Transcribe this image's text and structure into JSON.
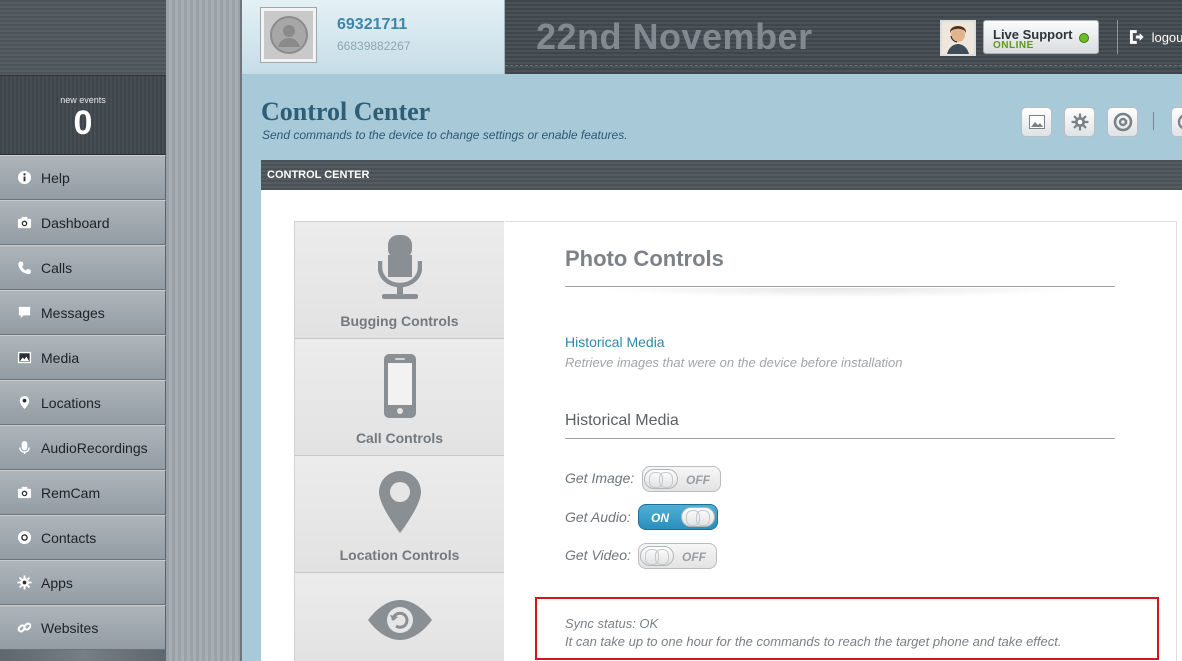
{
  "sidebar": {
    "events_label": "new events",
    "events_count": "0",
    "items": [
      {
        "label": "Help",
        "icon": "info-icon"
      },
      {
        "label": "Dashboard",
        "icon": "camera-icon"
      },
      {
        "label": "Calls",
        "icon": "phone-icon"
      },
      {
        "label": "Messages",
        "icon": "message-icon"
      },
      {
        "label": "Media",
        "icon": "image-icon"
      },
      {
        "label": "Locations",
        "icon": "location-pin-icon"
      },
      {
        "label": "AudioRecordings",
        "icon": "microphone-icon"
      },
      {
        "label": "RemCam",
        "icon": "camera-icon"
      },
      {
        "label": "Contacts",
        "icon": "contacts-icon"
      },
      {
        "label": "Apps",
        "icon": "gear-icon"
      },
      {
        "label": "Websites",
        "icon": "link-icon"
      }
    ]
  },
  "header": {
    "phone_number": "69321711",
    "imei": "66839882267",
    "date": "22nd November",
    "support_title": "Live Support",
    "support_status": "ONLINE",
    "logout_label": "logout"
  },
  "control_center": {
    "title": "Control Center",
    "subtitle": "Send commands to the device to change settings or enable features.",
    "bar_label": "CONTROL CENTER",
    "toolbar_icons": [
      "image-icon",
      "gear-icon",
      "at-icon",
      "circle-icon"
    ]
  },
  "tabs": [
    {
      "label": "Bugging Controls",
      "icon": "microphone-icon"
    },
    {
      "label": "Call Controls",
      "icon": "mobile-phone-icon"
    },
    {
      "label": "Location Controls",
      "icon": "location-pin-icon"
    },
    {
      "label": "",
      "icon": "eye-refresh-icon"
    }
  ],
  "photo": {
    "title": "Photo Controls",
    "link_label": "Historical Media",
    "link_description": "Retrieve images that were on the device before installation",
    "section_heading": "Historical Media",
    "controls": [
      {
        "label": "Get Image:",
        "state": "OFF"
      },
      {
        "label": "Get Audio:",
        "state": "ON"
      },
      {
        "label": "Get Video:",
        "state": "OFF"
      }
    ],
    "sync_status": "Sync status: OK",
    "sync_note": "It can take up to one hour for the commands to reach the target phone and take effect."
  },
  "colors": {
    "accent_blue": "#2b8aa8",
    "toggle_on": "#2a8fbd",
    "alert_red": "#d6141c",
    "online_green": "#6bbd2a"
  }
}
